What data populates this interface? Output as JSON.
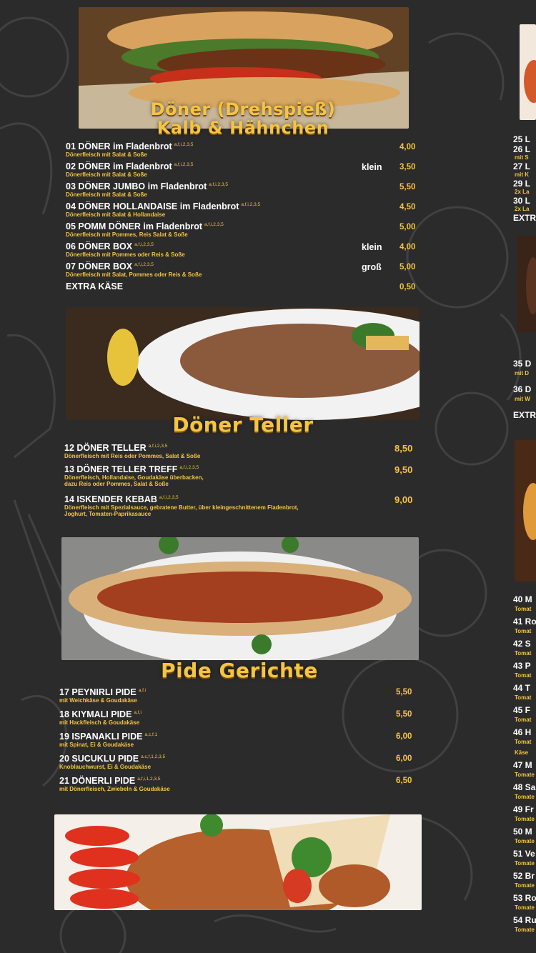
{
  "colors": {
    "background": "#2b2b2b",
    "accent": "#f5c542",
    "text": "#ffffff"
  },
  "sections": {
    "doener": {
      "title_line1": "Döner (Drehspieß)",
      "title_line2": "Kalb & Hähnchen",
      "items": [
        {
          "name": "01 DÖNER im Fladenbrot",
          "sup": "a,f,i,2,3,5",
          "desc": "Dönerfleisch mit Salat & Soße",
          "size": "",
          "price": "4,00"
        },
        {
          "name": "02 DÖNER im Fladenbrot",
          "sup": "a,f,i,2,3,5",
          "desc": "Dönerfleisch mit Salat & Soße",
          "size": "klein",
          "price": "3,50"
        },
        {
          "name": "03 DÖNER JUMBO im Fladenbrot",
          "sup": "a,f,i,2,3,5",
          "desc": "Dönerfleisch mit Salat & Soße",
          "size": "",
          "price": "5,50"
        },
        {
          "name": "04 DÖNER HOLLANDAISE im Fladenbrot",
          "sup": "a,f,i,2,3,5",
          "desc": "Dönerfleisch mit Salat & Hollandaise",
          "size": "",
          "price": "4,50"
        },
        {
          "name": "05 POMM DÖNER im Fladenbrot",
          "sup": "a,f,i,2,3,5",
          "desc": "Dönerfleisch mit Pommes, Reis Salat & Soße",
          "size": "",
          "price": "5,00"
        },
        {
          "name": "06 DÖNER BOX",
          "sup": "a,f,i,2,3,5",
          "desc": "Dönerfleisch mit Pommes oder Reis & Soße",
          "size": "klein",
          "price": "4,00"
        },
        {
          "name": "07 DÖNER BOX",
          "sup": "a,f,i,2,3,5",
          "desc": "Dönerfleisch mit Salat, Pommes oder Reis & Soße",
          "size": "groß",
          "price": "5,00"
        },
        {
          "name": "EXTRA KÄSE",
          "sup": "",
          "desc": "",
          "size": "",
          "price": "0,50"
        }
      ]
    },
    "teller": {
      "title": "Döner Teller",
      "items": [
        {
          "name": "12 DÖNER TELLER",
          "sup": "a,f,i,2,3,5",
          "desc": "Dönerfleisch mit Reis oder Pommes, Salat & Soße",
          "desc2": "",
          "price": "8,50"
        },
        {
          "name": "13 DÖNER TELLER TREFF",
          "sup": "a,f,i,2,3,5",
          "desc": "Dönerfleisch, Hollandaise, Goudakäse überbacken,",
          "desc2": "dazu Reis oder Pommes, Salat & Soße",
          "price": "9,50"
        },
        {
          "name": "14 ISKENDER KEBAB",
          "sup": "a,f,i,2,3,5",
          "desc": "Dönerfleisch mit Spezialsauce, gebratene Butter, über  kleingeschnittenem Fladenbrot,",
          "desc2": "Joghurt, Tomaten-Paprikasauce",
          "price": "9,00"
        }
      ]
    },
    "pide": {
      "title": "Pide Gerichte",
      "items": [
        {
          "name": "17 PEYNIRLI PIDE",
          "sup": "a,f,i",
          "desc": "mit Weichkäse & Goudakäse",
          "price": "5,50"
        },
        {
          "name": "18 KIYMALI PIDE",
          "sup": "a,f,i",
          "desc": "mit Hackfleisch & Goudakäse",
          "price": "5,50"
        },
        {
          "name": "19 ISPANAKLI PIDE",
          "sup": "a,c,f,1",
          "desc": "mit Spinat, Ei & Goudakäse",
          "price": "6,00"
        },
        {
          "name": "20 SUCUKLU PIDE",
          "sup": "a,c,f,1,2,3,5",
          "desc": "Knoblauchwurst, Ei & Goudakäse",
          "price": "6,00"
        },
        {
          "name": "21 DÖNERLI PIDE",
          "sup": "a,f,i,1,2,3,5",
          "desc": "mit Dönerfleisch, Zwiebeln & Goudakäse",
          "price": "6,50"
        }
      ]
    }
  },
  "right_column": {
    "lines": [
      {
        "text": "25 L",
        "kind": "main"
      },
      {
        "text": "26 L",
        "kind": "main"
      },
      {
        "text": "mit S",
        "kind": "sub"
      },
      {
        "text": "27 L",
        "kind": "main"
      },
      {
        "text": "mit K",
        "kind": "sub"
      },
      {
        "text": "29 L",
        "kind": "main"
      },
      {
        "text": "2x La",
        "kind": "sub"
      },
      {
        "text": "30 L",
        "kind": "main"
      },
      {
        "text": "2x La",
        "kind": "sub"
      },
      {
        "text": "EXTR",
        "kind": "main"
      }
    ],
    "lines2": [
      {
        "text": "35 D",
        "kind": "main"
      },
      {
        "text": "mit D",
        "kind": "sub"
      },
      {
        "text": "36 D",
        "kind": "main"
      },
      {
        "text": "mit W",
        "kind": "sub"
      },
      {
        "text": "EXTR",
        "kind": "main"
      }
    ],
    "lines3": [
      {
        "text": "40 M",
        "kind": "main"
      },
      {
        "text": "Tomat",
        "kind": "sub"
      },
      {
        "text": "41 Ro",
        "kind": "main"
      },
      {
        "text": "Tomat",
        "kind": "sub"
      },
      {
        "text": "42 S",
        "kind": "main"
      },
      {
        "text": "Tomat",
        "kind": "sub"
      },
      {
        "text": "43 P",
        "kind": "main"
      },
      {
        "text": "Tomat",
        "kind": "sub"
      },
      {
        "text": "44 T",
        "kind": "main"
      },
      {
        "text": "Tomat",
        "kind": "sub"
      },
      {
        "text": "45 F",
        "kind": "main"
      },
      {
        "text": "Tomat",
        "kind": "sub"
      },
      {
        "text": "46 H",
        "kind": "main"
      },
      {
        "text": "Tomat",
        "kind": "sub"
      },
      {
        "text": "Käse",
        "kind": "sub"
      },
      {
        "text": "47 M",
        "kind": "main"
      },
      {
        "text": "Tomate",
        "kind": "sub"
      },
      {
        "text": "48 Sa",
        "kind": "main"
      },
      {
        "text": "Tomate",
        "kind": "sub"
      },
      {
        "text": "49 Fr",
        "kind": "main"
      },
      {
        "text": "Tomate",
        "kind": "sub"
      },
      {
        "text": "50 M",
        "kind": "main"
      },
      {
        "text": "Tomate",
        "kind": "sub"
      },
      {
        "text": "51 Ve",
        "kind": "main"
      },
      {
        "text": "Tomate",
        "kind": "sub"
      },
      {
        "text": "52 Br",
        "kind": "main"
      },
      {
        "text": "Tomate",
        "kind": "sub"
      },
      {
        "text": "53 Ro",
        "kind": "main"
      },
      {
        "text": "Tomate",
        "kind": "sub"
      },
      {
        "text": "54 Ru",
        "kind": "main"
      },
      {
        "text": "Tomate",
        "kind": "sub"
      }
    ]
  }
}
